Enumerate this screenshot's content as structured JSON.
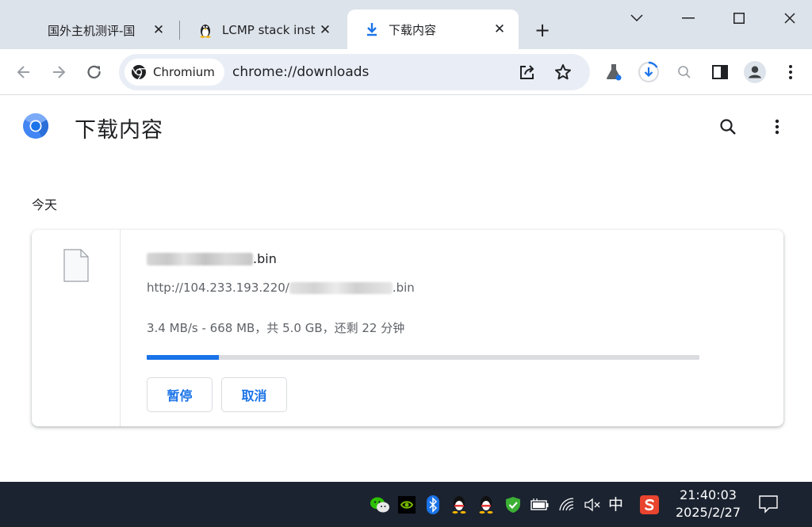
{
  "tabs": [
    {
      "title": "国外主机测评-国"
    },
    {
      "title": "LCMP stack inst"
    },
    {
      "title": "下载内容"
    }
  ],
  "new_tab_label": "+",
  "omnibox": {
    "chip_label": "Chromium",
    "url": "chrome://downloads"
  },
  "page": {
    "title": "下载内容",
    "section_label": "今天"
  },
  "download": {
    "file_suffix": ".bin",
    "url_prefix": "http://104.233.193.220/",
    "url_suffix": ".bin",
    "status": "3.4 MB/s - 668 MB，共 5.0 GB，还剩 22 分钟",
    "progress_percent": 13,
    "pause_label": "暂停",
    "cancel_label": "取消"
  },
  "taskbar": {
    "ime_label": "中",
    "time": "21:40:03",
    "date": "2025/2/27"
  },
  "colors": {
    "accent": "#1a73e8",
    "tabstrip": "#dde3ea",
    "omnibox": "#e9eef6",
    "taskbar": "#1b2330"
  },
  "icons": [
    "linux-penguin-icon",
    "download-icon",
    "back-arrow-icon",
    "forward-arrow-icon",
    "reload-icon",
    "chromium-icon",
    "share-icon",
    "star-icon",
    "lab-flask-icon",
    "download-progress-icon",
    "zoom-icon",
    "side-panel-icon",
    "profile-avatar-icon",
    "more-vert-icon",
    "search-icon",
    "file-icon",
    "wechat-icon",
    "nvidia-icon",
    "bluetooth-icon",
    "qq-icon",
    "security-shield-icon",
    "battery-icon",
    "wifi-icon",
    "speaker-muted-icon",
    "sogou-ime-icon",
    "notification-icon"
  ]
}
